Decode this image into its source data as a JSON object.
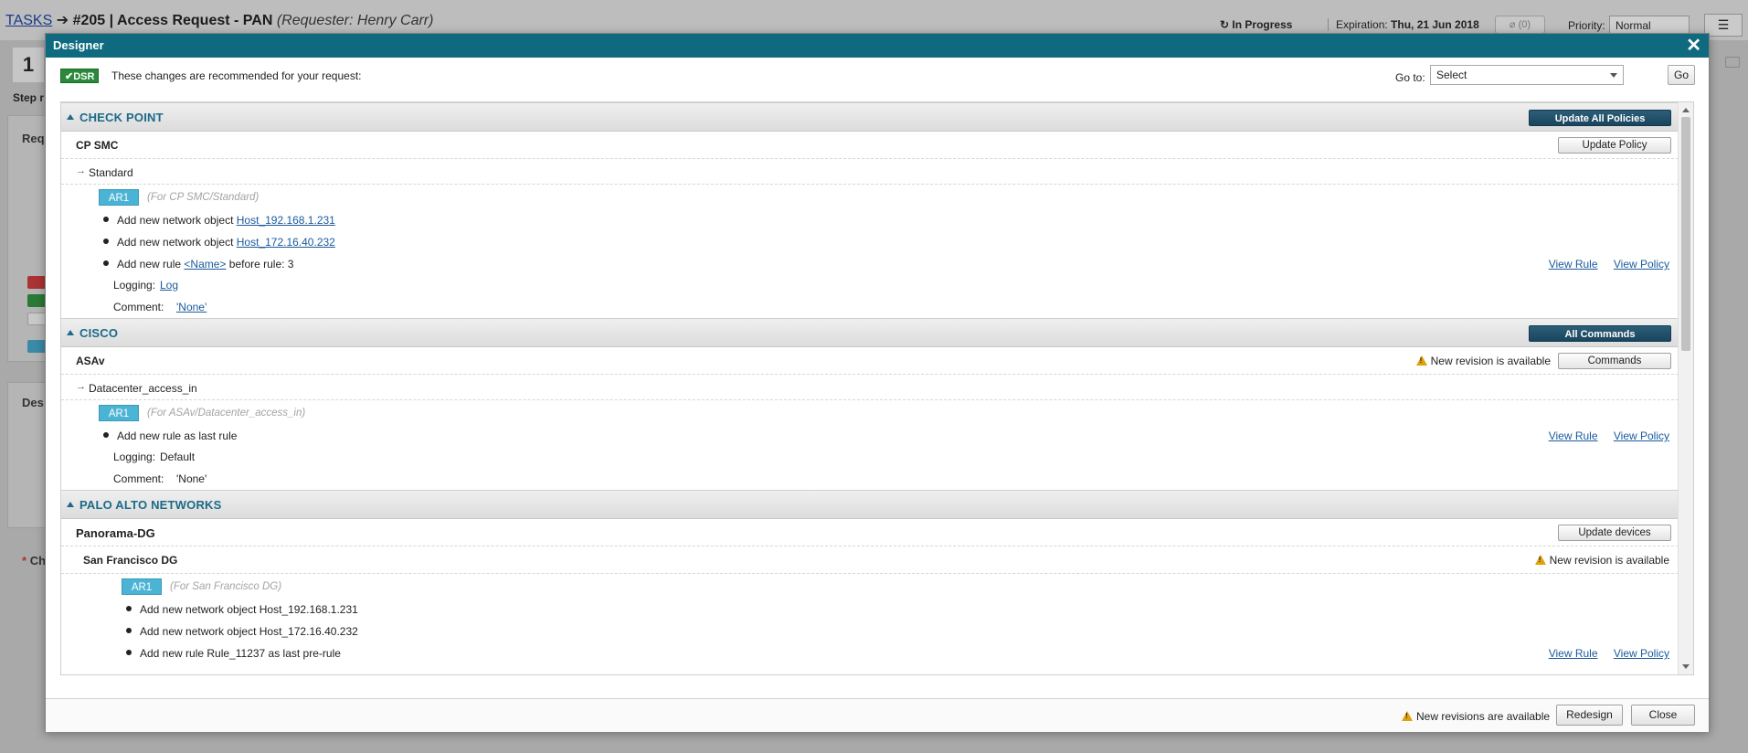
{
  "background": {
    "breadcrumb": {
      "link": "TASKS",
      "arrow": "➔",
      "title": "#205 | Access Request - PAN",
      "requester": "(Requester: Henry Carr)"
    },
    "status": "In Progress",
    "expiration_label": "Expiration:",
    "expiration_value": "Thu, 21 Jun 2018",
    "attachments": "(0)",
    "priority_label": "Priority:",
    "priority_value": "Normal",
    "step_number": "1",
    "step_text": "Step r",
    "section1": "Req",
    "section2": "Des",
    "section3": "Ch",
    "section3_star": "*"
  },
  "dialog": {
    "title": "Designer",
    "close_glyph": "✕",
    "dsr_badge": "✔DSR",
    "dsr_text": "These changes are recommended for your request:",
    "goto_label": "Go to:",
    "goto_value": "Select",
    "go_button": "Go",
    "footer": {
      "note": "New revisions are available",
      "redesign": "Redesign",
      "close": "Close"
    }
  },
  "vendors": {
    "checkpoint": {
      "name": "CHECK POINT",
      "action": "Update All Policies",
      "device": "CP SMC",
      "device_action": "Update Policy",
      "policy_arrow": "→",
      "policy": "Standard",
      "ar": {
        "badge": "AR1",
        "for": "(For CP SMC/Standard)",
        "line1_prefix": "Add new network object",
        "line1_link": "Host_192.168.1.231",
        "line2_prefix": "Add new network object",
        "line2_link": "Host_172.16.40.232",
        "line3_prefix": "Add new rule",
        "line3_link": "<Name>",
        "line3_suffix": "before rule: 3",
        "view_rule": "View Rule",
        "view_policy": "View Policy",
        "logging_label": "Logging:",
        "logging_value": "Log",
        "comment_label": "Comment:",
        "comment_value": "'None'"
      }
    },
    "cisco": {
      "name": "CISCO",
      "action": "All Commands",
      "device": "ASAv",
      "revision_note": "New revision is available",
      "device_action": "Commands",
      "policy_arrow": "→",
      "policy": "Datacenter_access_in",
      "ar": {
        "badge": "AR1",
        "for": "(For ASAv/Datacenter_access_in)",
        "line1": "Add new rule as last rule",
        "view_rule": "View Rule",
        "view_policy": "View Policy",
        "logging_label": "Logging:",
        "logging_value": "Default",
        "comment_label": "Comment:",
        "comment_value": "'None'"
      }
    },
    "paloalto": {
      "name": "PALO ALTO NETWORKS",
      "device": "Panorama-DG",
      "device_action": "Update devices",
      "subdevice": "San Francisco DG",
      "revision_note": "New revision is available",
      "ar": {
        "badge": "AR1",
        "for": "(For San Francisco DG)",
        "line1": "Add new network object Host_192.168.1.231",
        "line2": "Add new network object Host_172.16.40.232",
        "line3": "Add new rule Rule_11237 as last pre-rule",
        "view_rule": "View Rule",
        "view_policy": "View Policy"
      }
    }
  },
  "colors": {
    "dialog_title_bar": "#0f6a80",
    "vendor_name": "#1b6a88",
    "ar_badge": "#4bb4d4",
    "dsr_badge": "#2a8a3a",
    "link": "#1a5a9c",
    "warning": "#e1a10a"
  }
}
